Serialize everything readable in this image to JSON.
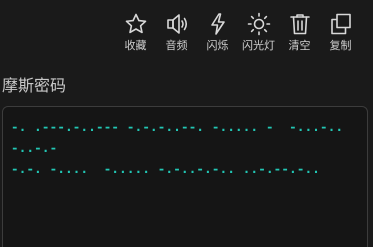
{
  "toolbar": {
    "items": [
      {
        "label": "收藏",
        "icon": "star-icon"
      },
      {
        "label": "音频",
        "icon": "speaker-icon"
      },
      {
        "label": "闪烁",
        "icon": "lightning-icon"
      },
      {
        "label": "闪光灯",
        "icon": "sun-icon"
      },
      {
        "label": "清空",
        "icon": "trash-icon"
      },
      {
        "label": "复制",
        "icon": "copy-icon"
      }
    ]
  },
  "section": {
    "title": "摩斯密码"
  },
  "morse": {
    "text": "-. .---.-..--- -.-.-..--. -..... -  -...-..-..-.-\n-.-. -....  -..... -.-..-.-.. ..-.--.-..",
    "color": "#22c6b4"
  },
  "colors": {
    "background": "#1a1a1a",
    "accent": "#22c6b4"
  }
}
